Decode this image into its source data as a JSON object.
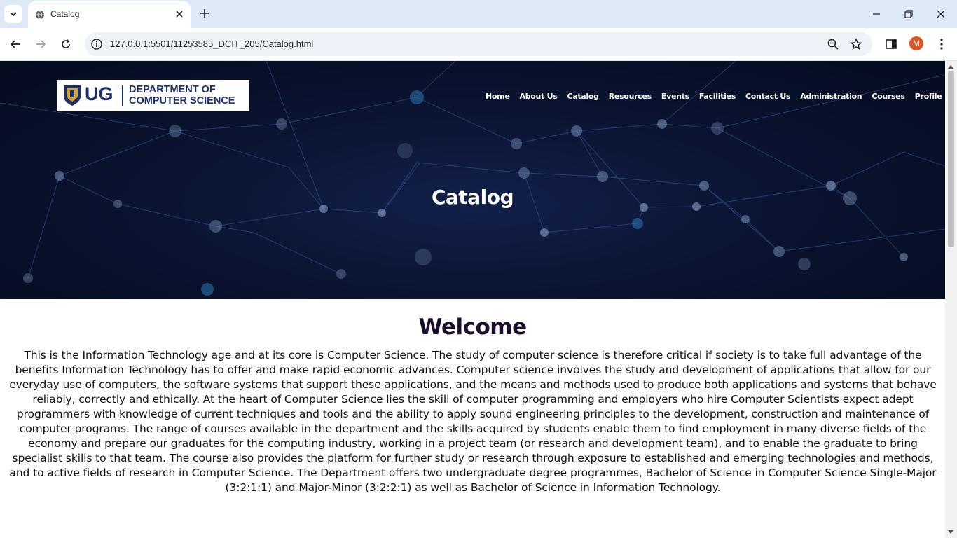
{
  "browser": {
    "tab_title": "Catalog",
    "url": "127.0.0.1:5501/11253585_DCIT_205/Catalog.html",
    "profile_initial": "M"
  },
  "site": {
    "logo_abbrev": "UG",
    "logo_dept_line1": "DEPARTMENT OF",
    "logo_dept_line2": "COMPUTER SCIENCE",
    "nav": [
      "Home",
      "About Us",
      "Catalog",
      "Resources",
      "Events",
      "Facilities",
      "Contact Us",
      "Administration",
      "Courses",
      "Profile"
    ],
    "hero_title": "Catalog"
  },
  "content": {
    "heading": "Welcome",
    "paragraph": "This is the Information Technology age and at its core is Computer Science. The study of computer science is therefore critical if society is to take full advantage of the benefits Information Technology has to offer and make rapid economic advances. Computer science involves the study and development of applications that allow for our everyday use of computers, the software systems that support these applications, and the means and methods used to produce both applications and systems that behave reliably, correctly and ethically. At the heart of Computer Science lies the skill of computer programming and employers who hire Computer Scientists expect adept programmers with knowledge of current techniques and tools and the ability to apply sound engineering principles to the development, construction and maintenance of computer programs. The range of courses available in the department and the skills acquired by students enable them to find employment in many diverse fields of the economy and prepare our graduates for the computing industry, working in a project team (or research and development team), and to enable the graduate to bring specialist skills to that team. The course also provides the platform for further study or research through exposure to established and emerging technologies and methods, and to active fields of research in Computer Science. The Department offers two undergraduate degree programmes, Bachelor of Science in Computer Science Single-Major (3:2:1:1) and Major-Minor (3:2:2:1) as well as Bachelor of Science in Information Technology."
  }
}
